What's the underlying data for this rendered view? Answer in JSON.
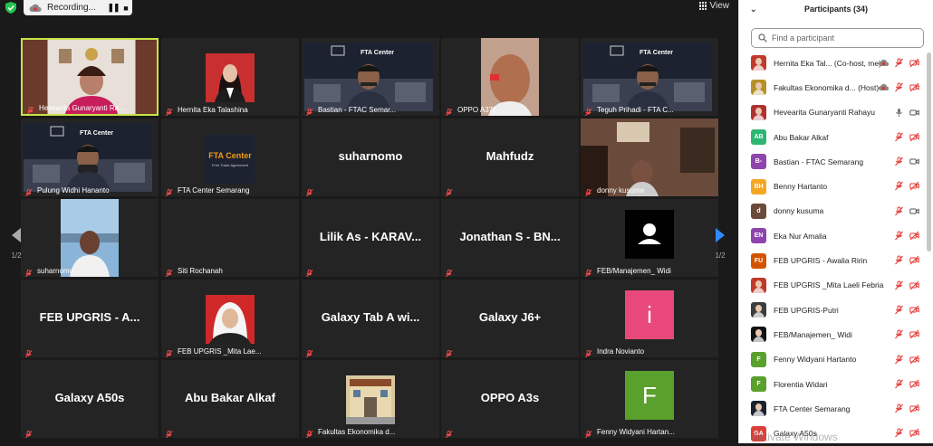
{
  "topbar": {
    "recording_label": "Recording...",
    "view_label": "View"
  },
  "gallery": {
    "page_left": "1/2",
    "page_right": "1/2",
    "tiles": [
      {
        "name": "Hevearita Gunaryanti Ra...",
        "kind": "video-woman"
      },
      {
        "name": "Hernita Eka Talashina",
        "kind": "photo-woman"
      },
      {
        "name": "Bastian - FTAC Semar...",
        "kind": "video-fta-man"
      },
      {
        "name": "OPPO A37f",
        "kind": "video-face"
      },
      {
        "name": "Teguh Prihadi - FTA C...",
        "kind": "video-fta-man"
      },
      {
        "name": "Pulung Widhi Hananto",
        "kind": "video-fta-mask"
      },
      {
        "name": "FTA Center Semarang",
        "kind": "fta-logo",
        "logo_title": "FTA Center",
        "logo_sub": "Free Trade Agreement"
      },
      {
        "name": "",
        "kind": "text",
        "big": "suharnomo"
      },
      {
        "name": "",
        "kind": "text",
        "big": "Mahfudz"
      },
      {
        "name": "donny kusuma",
        "kind": "video-room"
      },
      {
        "name": "suharnomo",
        "kind": "photo-man-harbor"
      },
      {
        "name": "Siti Rochanah",
        "kind": "blank"
      },
      {
        "name": "",
        "kind": "text",
        "big": "Lilik As - KARAV..."
      },
      {
        "name": "",
        "kind": "text",
        "big": "Jonathan S - BN..."
      },
      {
        "name": "FEB/Manajemen_ Widi",
        "kind": "avatar-user"
      },
      {
        "name": "",
        "kind": "text",
        "big": "FEB UPGRIS - A..."
      },
      {
        "name": "FEB UPGRIS _Mita Lae...",
        "kind": "photo-hijab"
      },
      {
        "name": "",
        "kind": "text",
        "big": "Galaxy Tab A wi..."
      },
      {
        "name": "",
        "kind": "text",
        "big": "Galaxy J6+"
      },
      {
        "name": "Indra Novianto",
        "kind": "letter",
        "letter": "i",
        "color": "#e8497a"
      },
      {
        "name": "",
        "kind": "text",
        "big": "Galaxy A50s"
      },
      {
        "name": "",
        "kind": "text",
        "big": "Abu Bakar Alkaf"
      },
      {
        "name": "Fakultas Ekonomika d...",
        "kind": "photo-building"
      },
      {
        "name": "",
        "kind": "text",
        "big": "OPPO A3s"
      },
      {
        "name": "Fenny Widyani Hartan...",
        "kind": "letter",
        "letter": "F",
        "color": "#5aa02c"
      }
    ]
  },
  "participants": {
    "title": "Participants (34)",
    "search_placeholder": "Find a participant",
    "list": [
      {
        "name": "Hernita Eka Tal...  (Co-host, me)",
        "initials": "",
        "color": "#c0392b",
        "photo": true,
        "video": "rec"
      },
      {
        "name": "Fakultas Ekonomika d...  (Host)",
        "initials": "",
        "color": "#b8902a",
        "photo": true,
        "video": "rec"
      },
      {
        "name": "Hevearita Gunaryanti Rahayu",
        "initials": "",
        "color": "#b03030",
        "photo": true,
        "mic": "on",
        "video": "on"
      },
      {
        "name": "Abu Bakar Alkaf",
        "initials": "AB",
        "color": "#2bb673"
      },
      {
        "name": "Bastian - FTAC Semarang",
        "initials": "B-",
        "color": "#8e44ad",
        "video": "on"
      },
      {
        "name": "Benny Hartanto",
        "initials": "BH",
        "color": "#f5a623"
      },
      {
        "name": "donny kusuma",
        "initials": "d",
        "color": "#6b4a3a",
        "video": "on"
      },
      {
        "name": "Eka Nur Amalia",
        "initials": "EN",
        "color": "#8e44ad"
      },
      {
        "name": "FEB UPGRIS - Awalia Ririn",
        "initials": "FU",
        "color": "#d35400"
      },
      {
        "name": "FEB UPGRIS _Mita Laeli Febrianti",
        "initials": "",
        "color": "#c0392b",
        "photo": true
      },
      {
        "name": "FEB UPGRIS-Putri",
        "initials": "",
        "color": "#3d3d3d",
        "photo": true
      },
      {
        "name": "FEB/Manajemen_ Widi",
        "initials": "",
        "color": "#111111",
        "photo": true
      },
      {
        "name": "Fenny Widyani Hartanto",
        "initials": "F",
        "color": "#5aa02c"
      },
      {
        "name": "Florentia Widari",
        "initials": "F",
        "color": "#5aa02c"
      },
      {
        "name": "FTA Center Semarang",
        "initials": "",
        "color": "#1c2230",
        "photo": true
      },
      {
        "name": "Galaxy A50s",
        "initials": "GA",
        "color": "#d9413a"
      }
    ]
  },
  "watermark": "Activate Windows"
}
